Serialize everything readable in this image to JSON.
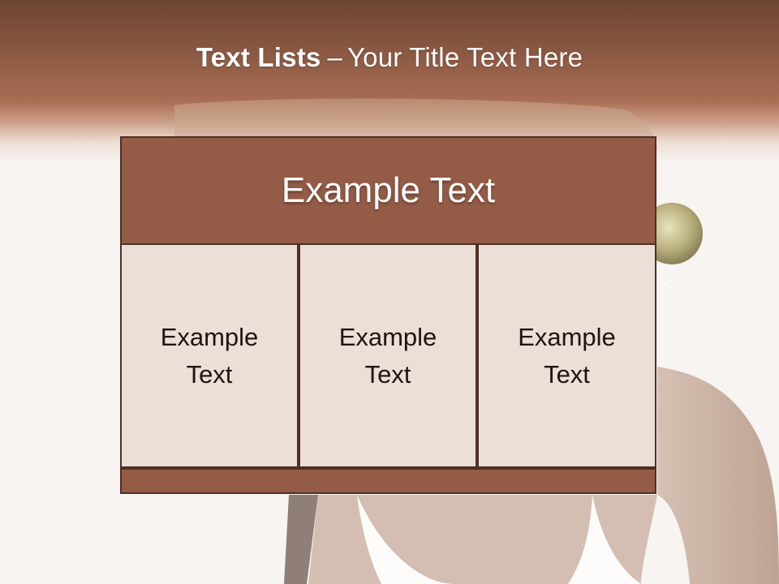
{
  "slide": {
    "title_bold": "Text Lists",
    "title_dash": "–",
    "title_rest": "Your Title Text Here"
  },
  "diagram": {
    "header": "Example Text",
    "cells": [
      "Example Text",
      "Example Text",
      "Example Text"
    ]
  },
  "colors": {
    "header_band": "#8d5a44",
    "box_fill": "#945c47",
    "cell_fill": "#ecdfd8",
    "border": "#4e3025",
    "background": "#f7f4f2"
  }
}
